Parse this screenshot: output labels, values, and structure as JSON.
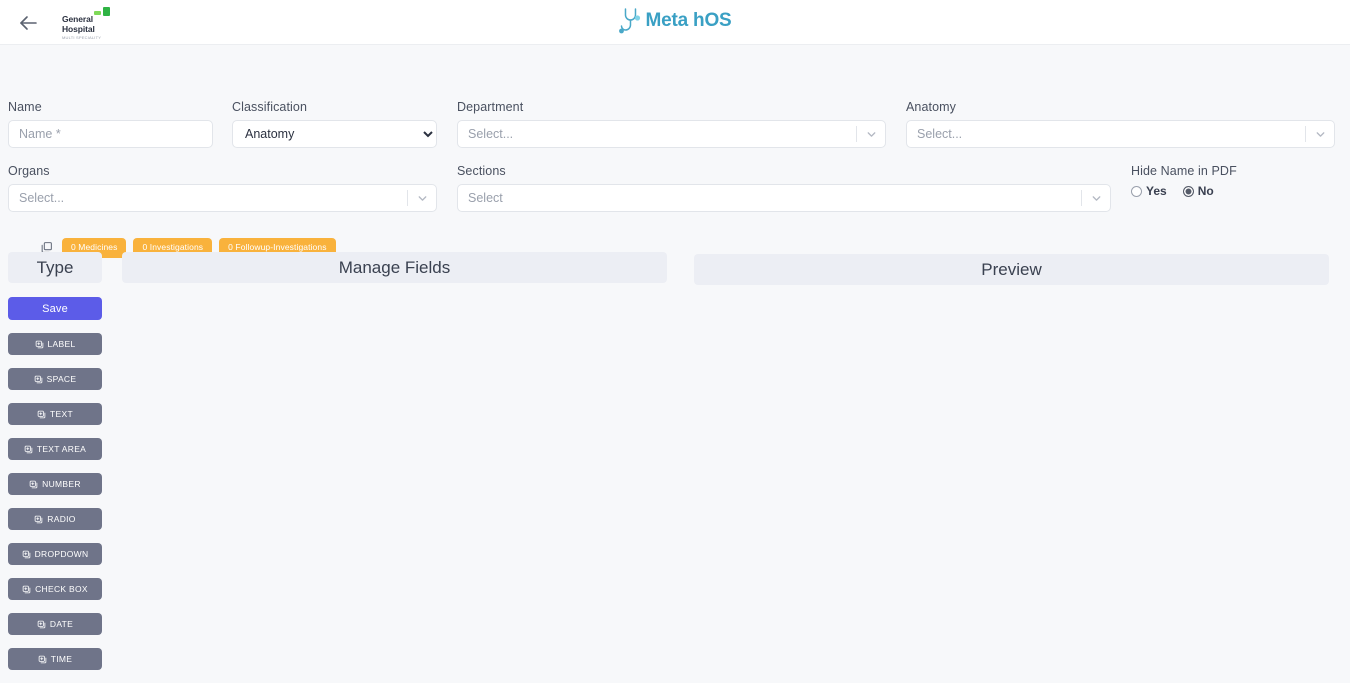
{
  "header": {
    "back_icon": "back-arrow-icon",
    "hospital_logo": {
      "name": "General\nHospital",
      "subtitle": "MULTI SPECIALITY"
    },
    "brand": {
      "icon": "stethoscope-icon",
      "text": "Meta hOS"
    }
  },
  "form": {
    "name": {
      "label": "Name",
      "value": "",
      "placeholder": "Name *"
    },
    "classification": {
      "label": "Classification",
      "value": "Anatomy",
      "options": [
        "Anatomy"
      ]
    },
    "department": {
      "label": "Department",
      "value": "",
      "placeholder": "Select..."
    },
    "anatomy": {
      "label": "Anatomy",
      "value": "",
      "placeholder": "Select..."
    },
    "organs": {
      "label": "Organs",
      "value": "",
      "placeholder": "Select..."
    },
    "sections": {
      "label": "Sections",
      "value": "",
      "placeholder": "Select"
    },
    "hide_name_in_pdf": {
      "label": "Hide Name in PDF",
      "options": [
        {
          "label": "Yes",
          "selected": false
        },
        {
          "label": "No",
          "selected": true
        }
      ]
    }
  },
  "badges": {
    "copy_icon": "copy-icon",
    "items": [
      {
        "label": "0 Medicines"
      },
      {
        "label": "0 Investigations"
      },
      {
        "label": "0 Followup-Investigations"
      }
    ],
    "color": "#f9b23c"
  },
  "panels": {
    "type_header": "Type",
    "manage_header": "Manage Fields",
    "preview_header": "Preview"
  },
  "type_buttons": [
    {
      "label": "Save",
      "icon": "",
      "variant": "save"
    },
    {
      "label": "LABEL",
      "icon": "add-square-icon",
      "variant": "default"
    },
    {
      "label": "SPACE",
      "icon": "add-square-icon",
      "variant": "default"
    },
    {
      "label": "TEXT",
      "icon": "add-square-icon",
      "variant": "default"
    },
    {
      "label": "TEXT AREA",
      "icon": "add-square-icon",
      "variant": "default"
    },
    {
      "label": "NUMBER",
      "icon": "add-square-icon",
      "variant": "default"
    },
    {
      "label": "RADIO",
      "icon": "add-square-icon",
      "variant": "default"
    },
    {
      "label": "DROPDOWN",
      "icon": "add-square-icon",
      "variant": "default"
    },
    {
      "label": "CHECK BOX",
      "icon": "add-square-icon",
      "variant": "default"
    },
    {
      "label": "DATE",
      "icon": "add-square-icon",
      "variant": "default"
    },
    {
      "label": "TIME",
      "icon": "add-square-icon",
      "variant": "default"
    }
  ],
  "colors": {
    "accent": "#5c5ce8",
    "badge": "#f9b23c",
    "type_button": "#6f7489",
    "panel_header": "#eceef4",
    "page_bg": "#f7f8fa"
  }
}
